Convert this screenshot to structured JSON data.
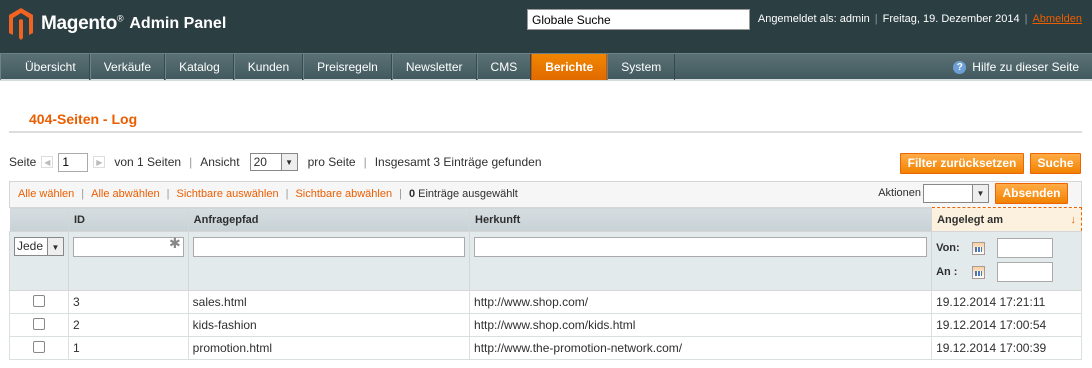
{
  "header": {
    "logo_text": "Magento",
    "logo_sub": "Admin Panel",
    "search_value": "Globale Suche",
    "logged_in": "Angemeldet als: admin",
    "date": "Freitag, 19. Dezember 2014",
    "logout": "Abmelden"
  },
  "nav": {
    "items": [
      "Übersicht",
      "Verkäufe",
      "Katalog",
      "Kunden",
      "Preisregeln",
      "Newsletter",
      "CMS",
      "Berichte",
      "System"
    ],
    "active": "Berichte",
    "help": "Hilfe zu dieser Seite"
  },
  "page": {
    "title": "404-Seiten - Log"
  },
  "pager": {
    "page_label": "Seite",
    "page_value": "1",
    "of_pages": "von 1 Seiten",
    "view_label": "Ansicht",
    "per_page": "20",
    "per_page_label": "pro Seite",
    "total": "Insgesamt 3 Einträge gefunden"
  },
  "buttons": {
    "reset_filter": "Filter zurücksetzen",
    "search": "Suche",
    "submit": "Absenden"
  },
  "massaction": {
    "select_all": "Alle wählen",
    "unselect_all": "Alle abwählen",
    "select_visible": "Sichtbare auswählen",
    "unselect_visible": "Sichtbare abwählen",
    "count": "0",
    "count_label": "Einträge ausgewählt",
    "actions_label": "Aktionen"
  },
  "grid": {
    "columns": {
      "id": "ID",
      "path": "Anfragepfad",
      "referer": "Herkunft",
      "created": "Angelegt am"
    },
    "filter": {
      "any": "Jede",
      "from": "Von:",
      "to": "An :"
    },
    "rows": [
      {
        "id": "3",
        "path": "sales.html",
        "referer": "http://www.shop.com/",
        "created": "19.12.2014 17:21:11"
      },
      {
        "id": "2",
        "path": "kids-fashion",
        "referer": "http://www.shop.com/kids.html",
        "created": "19.12.2014 17:00:54"
      },
      {
        "id": "1",
        "path": "promotion.html",
        "referer": "http://www.the-promotion-network.com/",
        "created": "19.12.2014 17:00:39"
      }
    ]
  },
  "colors": {
    "accent": "#eb5e00",
    "header_bg": "#2b3e42",
    "nav_bg": "#4e666b"
  }
}
